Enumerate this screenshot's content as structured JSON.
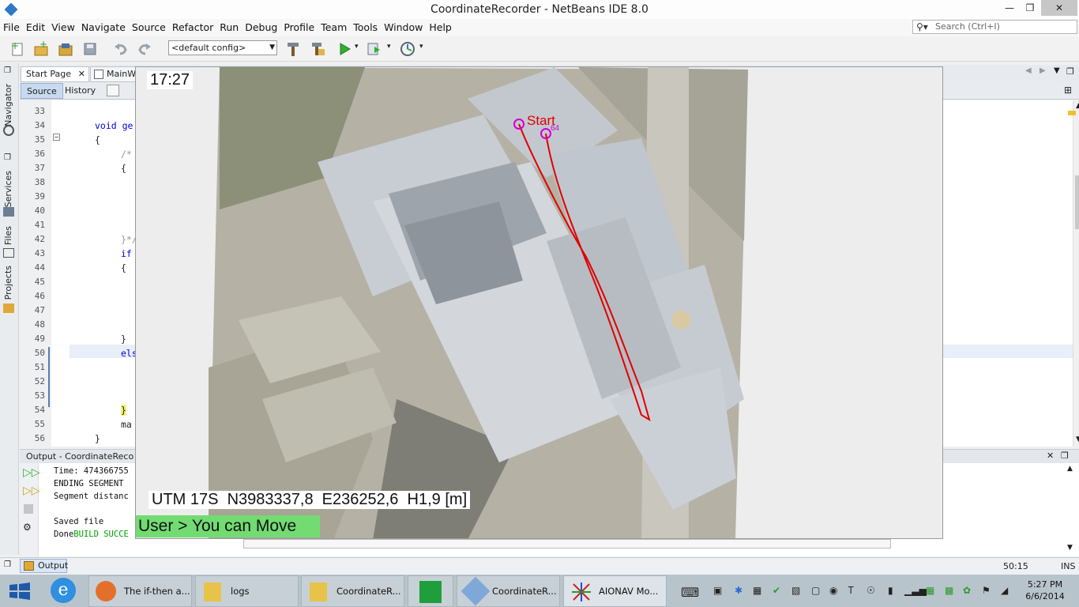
{
  "window": {
    "title": "CoordinateRecorder - NetBeans IDE 8.0"
  },
  "menubar": {
    "items": [
      "File",
      "Edit",
      "View",
      "Navigate",
      "Source",
      "Refactor",
      "Run",
      "Debug",
      "Profile",
      "Team",
      "Tools",
      "Window",
      "Help"
    ]
  },
  "search": {
    "placeholder": "Search (Ctrl+I)"
  },
  "toolbar": {
    "config": "<default config>"
  },
  "side_tabs": [
    "Navigator",
    "Services",
    "Files",
    "Projects"
  ],
  "editor": {
    "tabs": [
      "Start Page",
      "MainWi"
    ],
    "source_label": "Source",
    "history_label": "History",
    "lines": [
      {
        "n": "33",
        "code": ""
      },
      {
        "n": "34",
        "code": "void ge"
      },
      {
        "n": "35",
        "code": "{"
      },
      {
        "n": "36",
        "code": "/*"
      },
      {
        "n": "37",
        "code": "{"
      },
      {
        "n": "38",
        "code": ""
      },
      {
        "n": "39",
        "code": ""
      },
      {
        "n": "40",
        "code": ""
      },
      {
        "n": "41",
        "code": ""
      },
      {
        "n": "42",
        "code": "}*/"
      },
      {
        "n": "43",
        "code": "if"
      },
      {
        "n": "44",
        "code": "{"
      },
      {
        "n": "45",
        "code": ""
      },
      {
        "n": "46",
        "code": ""
      },
      {
        "n": "47",
        "code": ""
      },
      {
        "n": "48",
        "code": ""
      },
      {
        "n": "49",
        "code": "}"
      },
      {
        "n": "50",
        "code": "els"
      },
      {
        "n": "51",
        "code": ""
      },
      {
        "n": "52",
        "code": ""
      },
      {
        "n": "53",
        "code": ""
      },
      {
        "n": "54",
        "code": "}"
      },
      {
        "n": "55",
        "code": "ma"
      },
      {
        "n": "56",
        "code": "}"
      }
    ]
  },
  "output": {
    "title": "Output - CoordinateReco",
    "lines": [
      "Time: 474366755",
      "ENDING SEGMENT",
      "Segment distanc",
      "",
      "Saved file"
    ],
    "done_prefix": "Done",
    "done_suffix": "BUILD SUCCE",
    "tab_label": "Output"
  },
  "status": {
    "position": "50:15",
    "mode": "INS"
  },
  "map": {
    "time": "17:27",
    "utm": "UTM 17S  N3983337,8  E236252,6  H1,9 [m]",
    "start_label": "Start",
    "point_label": "64",
    "user_message": "User > You can Move",
    "track_color": "#e00000",
    "marker_color": "#d000d0"
  },
  "taskbar": {
    "items": [
      {
        "label": "The if-then a..."
      },
      {
        "label": "logs"
      },
      {
        "label": "CoordinateR..."
      },
      {
        "label": ""
      },
      {
        "label": "CoordinateR..."
      },
      {
        "label": "AIONAV Mo..."
      }
    ],
    "clock_time": "5:27 PM",
    "clock_date": "6/6/2014"
  }
}
